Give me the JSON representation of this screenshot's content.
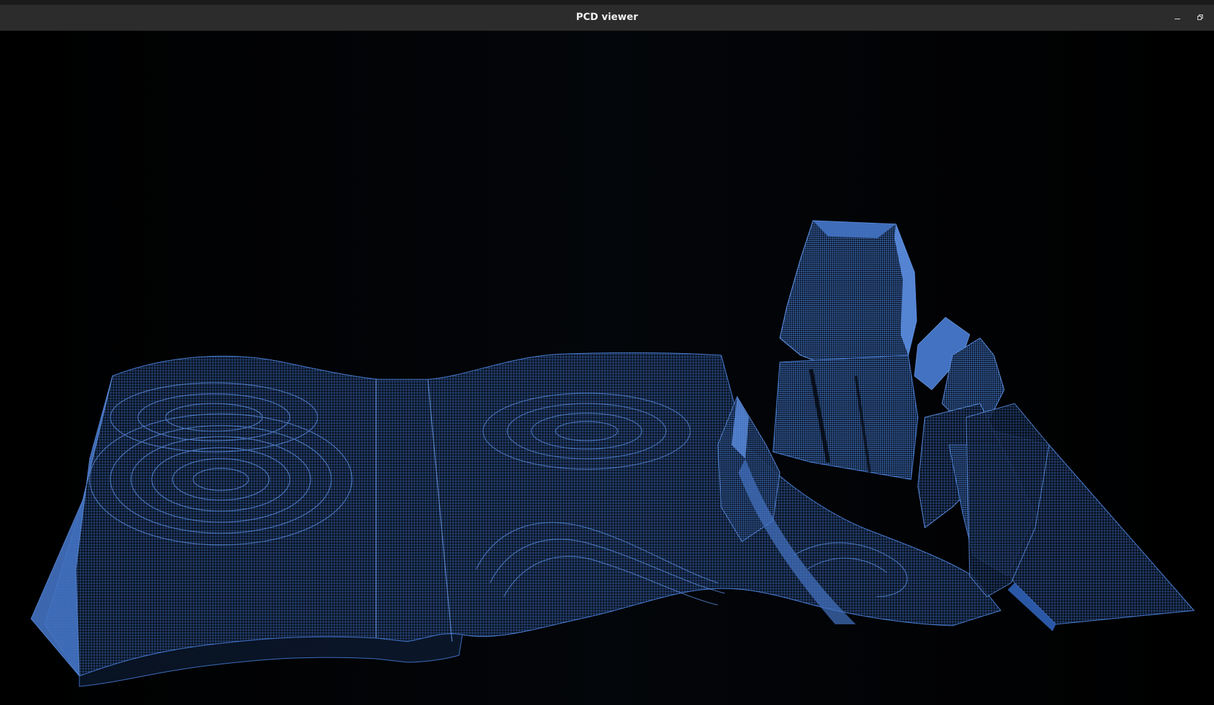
{
  "window": {
    "title": "PCD viewer",
    "background_color": "#000000",
    "titlebar_color": "#2c2c2c"
  },
  "controls": {
    "minimize_icon": "minimize-icon",
    "restore_icon": "restore-icon"
  },
  "viewer": {
    "point_color": "#4a7fd6",
    "content": "point-cloud-terrain"
  }
}
